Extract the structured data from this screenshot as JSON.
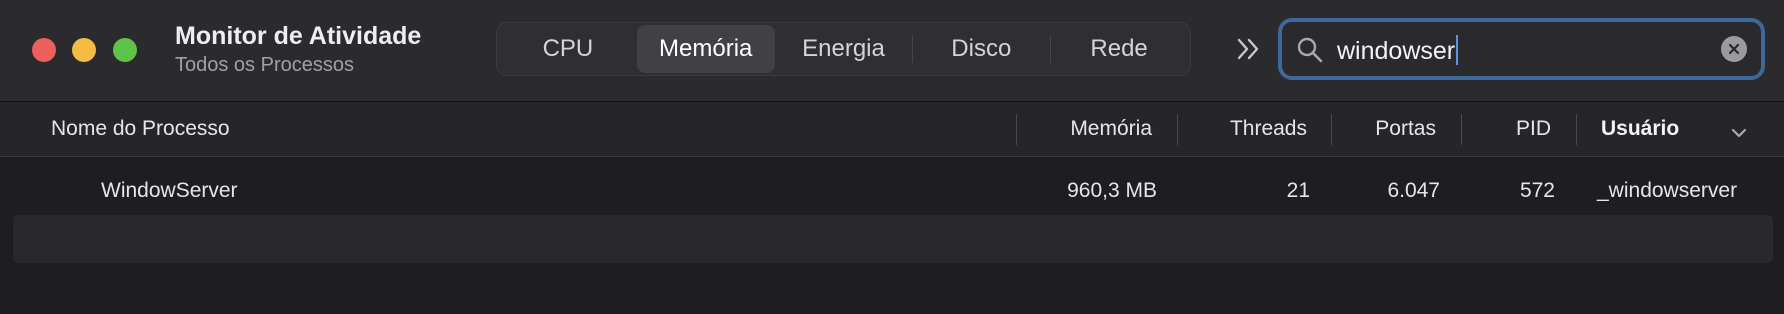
{
  "window": {
    "title": "Monitor de Atividade",
    "subtitle": "Todos os Processos",
    "traffic_lights": {
      "close": "#ec5f5a",
      "minimize": "#f2bd42",
      "zoom": "#5fc347"
    }
  },
  "tabs": [
    {
      "label": "CPU",
      "active": false
    },
    {
      "label": "Memória",
      "active": true
    },
    {
      "label": "Energia",
      "active": false
    },
    {
      "label": "Disco",
      "active": false
    },
    {
      "label": "Rede",
      "active": false
    }
  ],
  "toolbar": {
    "overflow_icon": "chevron-double-right-icon"
  },
  "search": {
    "value": "windowser",
    "icon": "magnifying-glass-icon",
    "clear_icon": "clear-x-icon",
    "focus_color": "#3e6897"
  },
  "columns": [
    {
      "label": "Nome do Processo"
    },
    {
      "label": "Memória"
    },
    {
      "label": "Threads"
    },
    {
      "label": "Portas"
    },
    {
      "label": "PID"
    },
    {
      "label": "Usuário",
      "sorted": true
    }
  ],
  "rows": [
    {
      "name": "WindowServer",
      "memory": "960,3 MB",
      "threads": "21",
      "ports": "6.047",
      "pid": "572",
      "user": "_windowserver"
    }
  ]
}
